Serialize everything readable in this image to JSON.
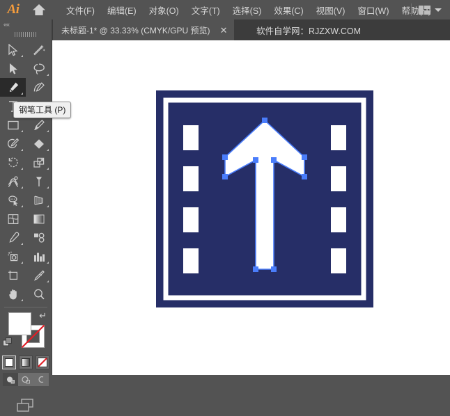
{
  "app": {
    "name": "Adobe Illustrator",
    "logo_text": "Ai",
    "home_icon": "home-icon"
  },
  "menubar": {
    "items": [
      {
        "label": "文件(F)",
        "name": "menu-file"
      },
      {
        "label": "编辑(E)",
        "name": "menu-edit"
      },
      {
        "label": "对象(O)",
        "name": "menu-object"
      },
      {
        "label": "文字(T)",
        "name": "menu-type"
      },
      {
        "label": "选择(S)",
        "name": "menu-select"
      },
      {
        "label": "效果(C)",
        "name": "menu-effect"
      },
      {
        "label": "视图(V)",
        "name": "menu-view"
      },
      {
        "label": "窗口(W)",
        "name": "menu-window"
      },
      {
        "label": "帮助(H)",
        "name": "menu-help"
      }
    ],
    "workspace_switcher_icon": "workspace-switcher-icon",
    "workspace_chevron_icon": "chevron-down-icon"
  },
  "tabbar": {
    "document_tab": {
      "title": "未标题-1* @ 33.33% (CMYK/GPU 预览)",
      "close_label": "✕"
    },
    "brand": "软件自学网：RJZXW.COM"
  },
  "toolpanel": {
    "collapse_label": "««",
    "tooltip": "钢笔工具 (P)",
    "active_tool": "pen-tool",
    "tools": [
      {
        "name": "selection-tool",
        "icon": "cursor-arrow-outline-icon",
        "has_corner": true
      },
      {
        "name": "magic-wand-tool",
        "icon": "magic-wand-icon",
        "has_corner": false
      },
      {
        "name": "direct-selection-tool",
        "icon": "cursor-arrow-filled-icon",
        "has_corner": false
      },
      {
        "name": "lasso-tool",
        "icon": "lasso-icon",
        "has_corner": true
      },
      {
        "name": "pen-tool",
        "icon": "pen-nib-icon",
        "has_corner": true
      },
      {
        "name": "curvature-tool",
        "icon": "curvature-pen-icon",
        "has_corner": false
      },
      {
        "name": "type-tool",
        "icon": "text-t-icon",
        "has_corner": true
      },
      {
        "name": "line-segment-tool",
        "icon": "line-diagonal-icon",
        "has_corner": true
      },
      {
        "name": "rectangle-tool",
        "icon": "rectangle-icon",
        "has_corner": true
      },
      {
        "name": "paintbrush-tool",
        "icon": "paintbrush-icon",
        "has_corner": true
      },
      {
        "name": "shaper-tool",
        "icon": "shaper-pencil-icon",
        "has_corner": true
      },
      {
        "name": "eraser-tool",
        "icon": "eraser-icon",
        "has_corner": true
      },
      {
        "name": "rotate-tool",
        "icon": "rotate-icon",
        "has_corner": true
      },
      {
        "name": "scale-tool",
        "icon": "scale-icon",
        "has_corner": true
      },
      {
        "name": "width-tool",
        "icon": "width-warp-icon",
        "has_corner": true
      },
      {
        "name": "free-transform-tool",
        "icon": "free-transform-pin-icon",
        "has_corner": true
      },
      {
        "name": "shape-builder-tool",
        "icon": "shape-builder-icon",
        "has_corner": true
      },
      {
        "name": "perspective-grid-tool",
        "icon": "perspective-grid-icon",
        "has_corner": true
      },
      {
        "name": "mesh-tool",
        "icon": "mesh-icon",
        "has_corner": false
      },
      {
        "name": "gradient-tool",
        "icon": "gradient-square-icon",
        "has_corner": false
      },
      {
        "name": "eyedropper-tool",
        "icon": "eyedropper-icon",
        "has_corner": true
      },
      {
        "name": "blend-tool",
        "icon": "blend-icon",
        "has_corner": false
      },
      {
        "name": "symbol-sprayer-tool",
        "icon": "symbol-sprayer-icon",
        "has_corner": true
      },
      {
        "name": "column-graph-tool",
        "icon": "bar-graph-icon",
        "has_corner": true
      },
      {
        "name": "artboard-tool",
        "icon": "artboard-icon",
        "has_corner": false
      },
      {
        "name": "slice-tool",
        "icon": "slice-knife-icon",
        "has_corner": true
      },
      {
        "name": "hand-tool",
        "icon": "hand-icon",
        "has_corner": true
      },
      {
        "name": "zoom-tool",
        "icon": "magnifier-icon",
        "has_corner": false
      }
    ],
    "fill_color": "#ffffff",
    "stroke_color": "#ffffff",
    "swap_icon": "swap-fill-stroke-icon",
    "default_icon": "default-fill-stroke-icon",
    "color_modes": [
      {
        "name": "color-mode-plain",
        "icon": "solid-color-icon",
        "selected": true
      },
      {
        "name": "color-mode-gradient",
        "icon": "gradient-color-icon",
        "selected": false
      },
      {
        "name": "color-mode-none",
        "icon": "none-color-icon",
        "selected": false
      }
    ],
    "draw_modes": [
      {
        "name": "draw-normal",
        "icon": "draw-normal-icon",
        "selected": true
      },
      {
        "name": "draw-behind",
        "icon": "draw-behind-icon",
        "selected": false
      },
      {
        "name": "draw-inside",
        "icon": "draw-inside-icon",
        "selected": false
      }
    ],
    "screen_mode": {
      "name": "screen-mode-button",
      "icon": "screen-mode-icon"
    }
  },
  "canvas": {
    "background": "#ffffff",
    "artwork": {
      "name": "road-sign-arrow-artwork",
      "sign_color": "#262e67",
      "marking_color": "#ffffff",
      "anchor_color": "#4a7dfb",
      "description": "蓝色直行路牌",
      "border_outer_width": 14,
      "dash_count_per_side": 4
    }
  }
}
